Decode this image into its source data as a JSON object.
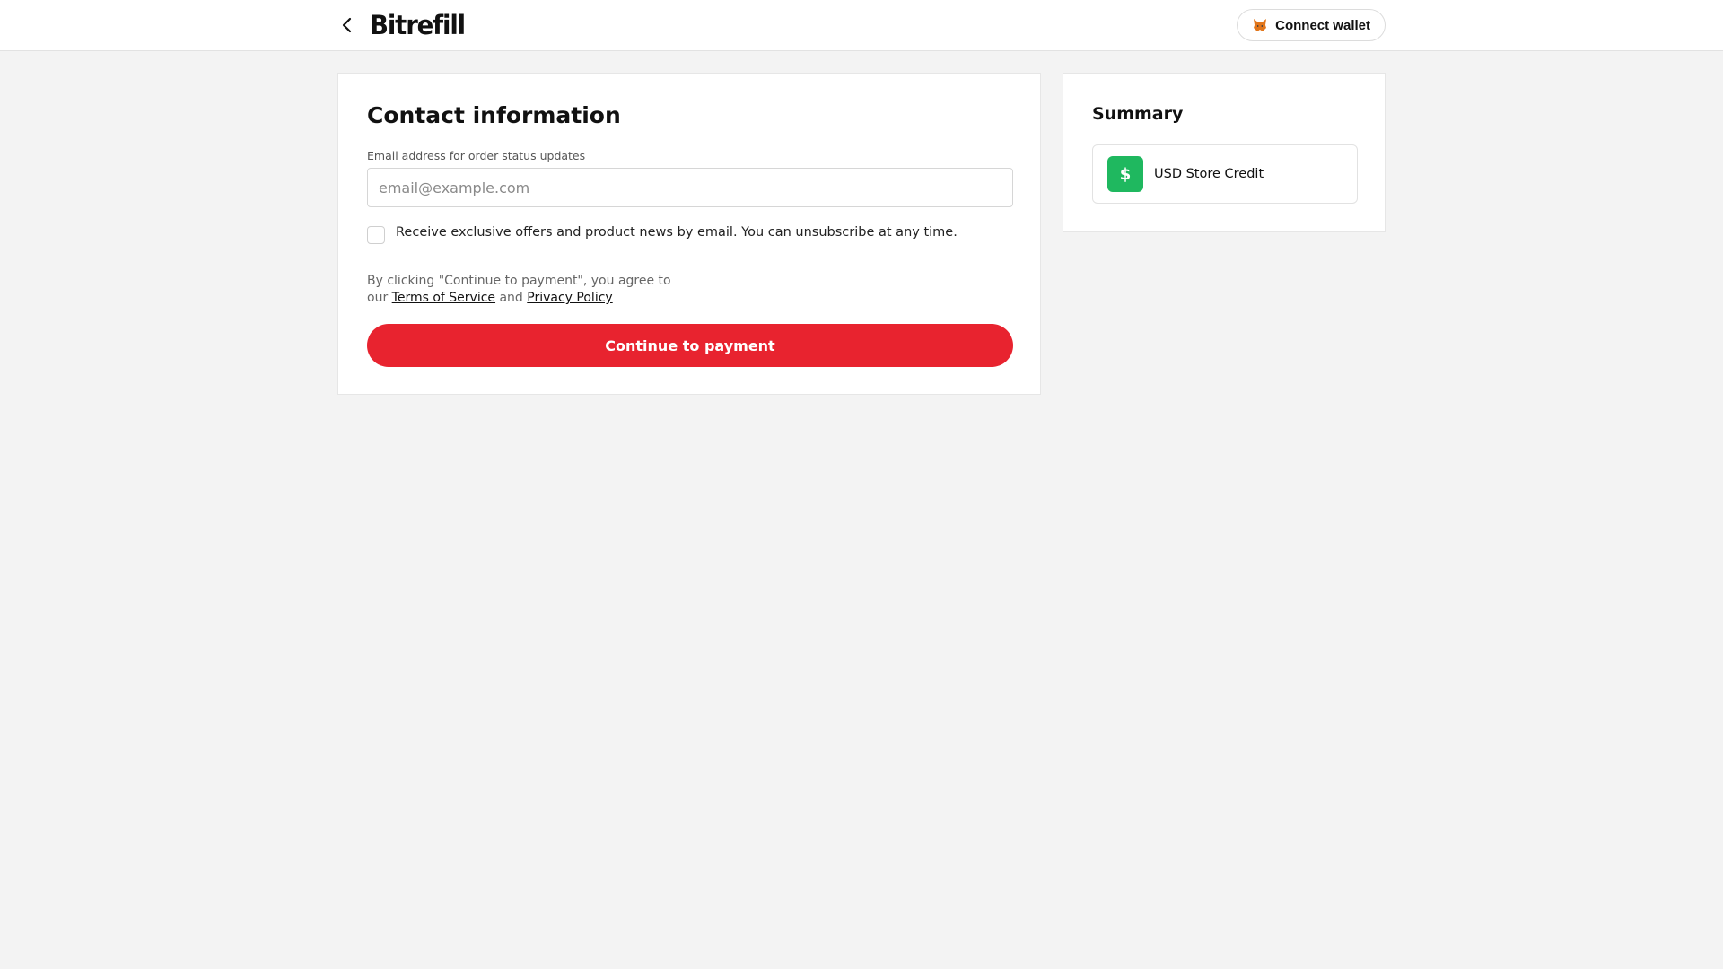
{
  "header": {
    "logo_text": "Bitrefill",
    "wallet_label": "Connect wallet",
    "back_icon": "chevron-left-icon",
    "wallet_icon": "fox-icon"
  },
  "contact": {
    "title": "Contact information",
    "email_label": "Email address for order status updates",
    "email_placeholder": "email@example.com",
    "email_value": "",
    "optin_text": "Receive exclusive offers and product news by email. You can unsubscribe at any time.",
    "legal_prefix": "By clicking \"Continue to payment\", you agree to our ",
    "terms_link": "Terms of Service",
    "legal_and": " and ",
    "privacy_link": "Privacy Policy",
    "continue_label": "Continue to payment"
  },
  "summary": {
    "title": "Summary",
    "item_icon": "$",
    "item_label": "USD Store Credit"
  },
  "colors": {
    "accent": "#e8232f",
    "credit_icon_bg": "#1fb85f",
    "page_bg": "#f3f3f3"
  }
}
